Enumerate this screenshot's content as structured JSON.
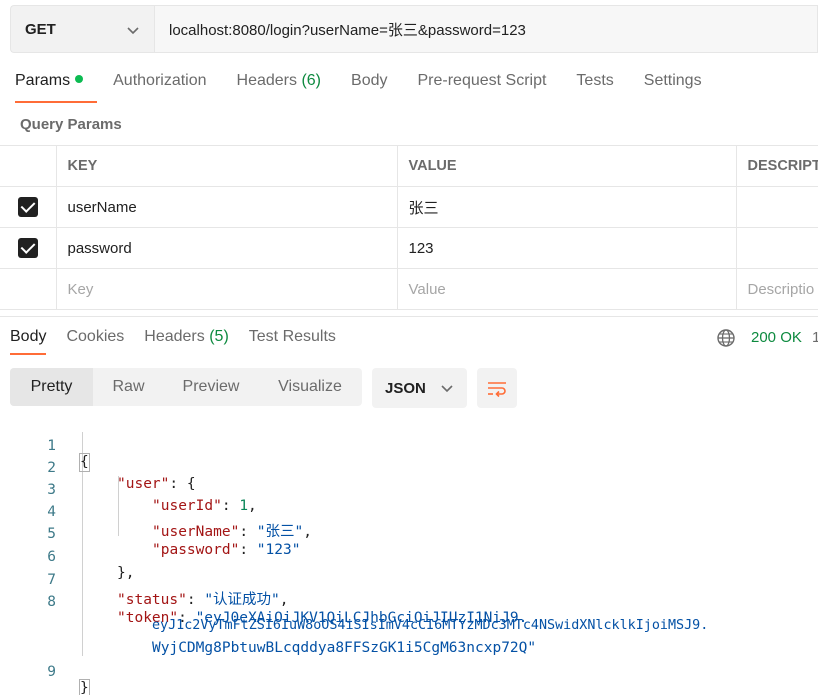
{
  "request": {
    "method": "GET",
    "url": "localhost:8080/login?userName=张三&password=123"
  },
  "request_tabs": [
    {
      "label": "Params",
      "active": true,
      "dot": true
    },
    {
      "label": "Authorization",
      "active": false
    },
    {
      "label": "Headers",
      "count": "(6)",
      "active": false
    },
    {
      "label": "Body",
      "active": false
    },
    {
      "label": "Pre-request Script",
      "active": false
    },
    {
      "label": "Tests",
      "active": false
    },
    {
      "label": "Settings",
      "active": false
    }
  ],
  "query_params": {
    "title": "Query Params",
    "columns": [
      "KEY",
      "VALUE",
      "DESCRIPT"
    ],
    "rows": [
      {
        "checked": true,
        "key": "userName",
        "value": "张三",
        "description": ""
      },
      {
        "checked": true,
        "key": "password",
        "value": "123",
        "description": ""
      }
    ],
    "placeholders": {
      "key": "Key",
      "value": "Value",
      "description": "Descriptio"
    }
  },
  "response_tabs": [
    {
      "label": "Body",
      "active": true
    },
    {
      "label": "Cookies",
      "active": false
    },
    {
      "label": "Headers",
      "count": "(5)",
      "active": false
    },
    {
      "label": "Test Results",
      "active": false
    }
  ],
  "response_status": {
    "status": "200 OK",
    "truncated": "1"
  },
  "view_modes": [
    "Pretty",
    "Raw",
    "Preview",
    "Visualize"
  ],
  "active_view": "Pretty",
  "format": "JSON",
  "colors": {
    "accent": "#ff6c37",
    "success": "#0d8a3f",
    "key": "#a31515",
    "string": "#0451a5",
    "number": "#098658"
  },
  "icons": [
    "chevron-down-icon",
    "globe-icon",
    "wrap-lines-icon",
    "checkbox-icon"
  ],
  "code_lines": [
    {
      "n": "1",
      "t": "{"
    },
    {
      "n": "2",
      "k": "\"user\"",
      "t": ": {"
    },
    {
      "n": "3",
      "k": "\"userId\"",
      "t": ": ",
      "v": "1",
      "vt": "num",
      "tail": ","
    },
    {
      "n": "4",
      "k": "\"userName\"",
      "t": ": ",
      "v": "\"张三\"",
      "vt": "str",
      "tail": ","
    },
    {
      "n": "5",
      "k": "\"password\"",
      "t": ": ",
      "v": "\"123\"",
      "vt": "str",
      "tail": ""
    },
    {
      "n": "6",
      "t": "},"
    },
    {
      "n": "7",
      "k": "\"status\"",
      "t": ": ",
      "v": "\"认证成功\"",
      "vt": "str",
      "tail": ","
    },
    {
      "n": "8",
      "k": "\"token\"",
      "t": ": ",
      "v": "\"eyJ0eXAiOiJKV1QiLCJhbGciOiJIUzI1NiJ9.",
      "vt": "str",
      "tail": ""
    },
    {
      "n": "",
      "v": "eyJ1c2VyTmFtZSI6IuW8oOS4iSIsImV4cCI6MTYzMDc3MTc4NSwidXNlcklkIjoiMSJ9.",
      "vt": "str"
    },
    {
      "n": "",
      "v": "WyjCDMg8PbtuwBLcqddya8FFSzGK1i5CgM63ncxp72Q\"",
      "vt": "str"
    },
    {
      "n": "9",
      "t": "}"
    }
  ]
}
